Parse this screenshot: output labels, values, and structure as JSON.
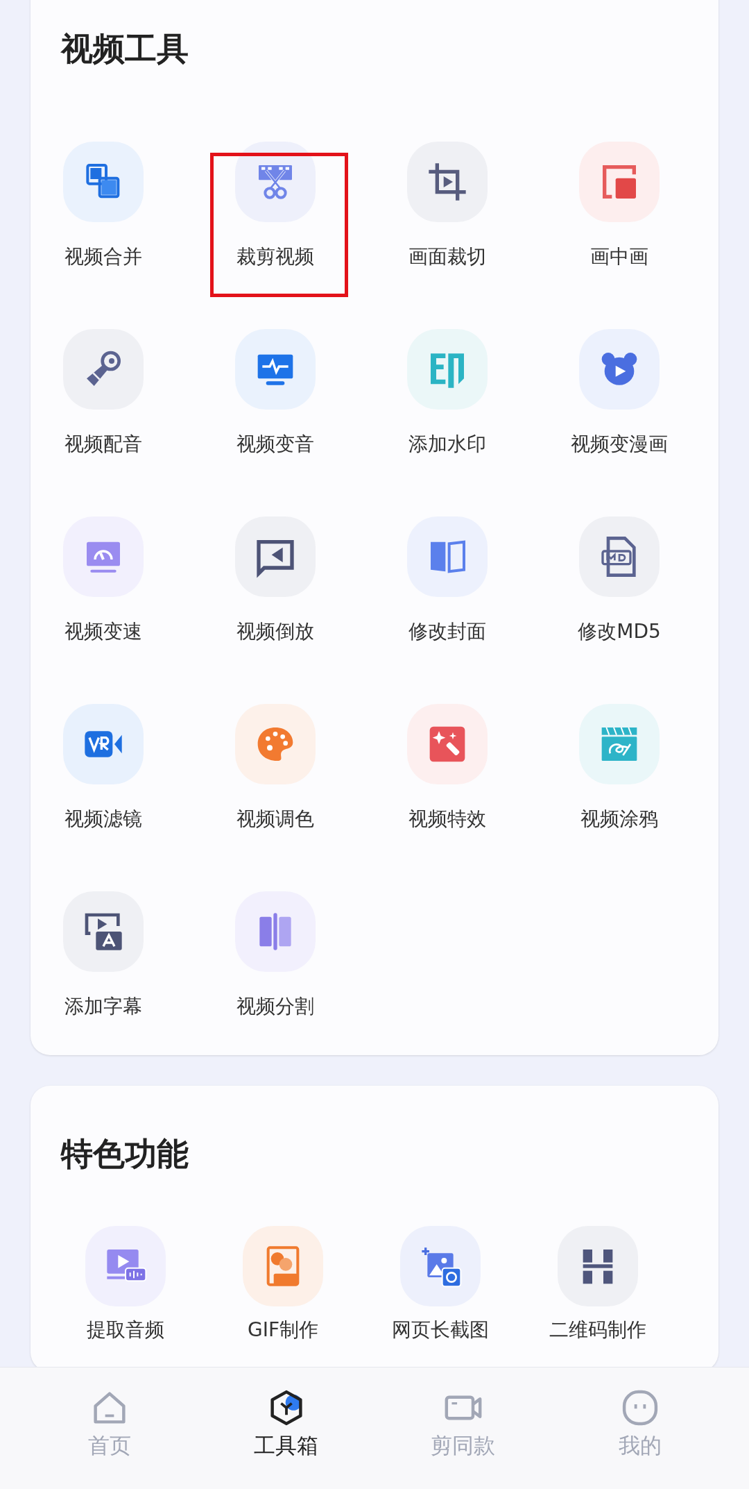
{
  "sections": [
    {
      "title": "视频工具",
      "items": [
        {
          "label": "视频合并",
          "highlighted": false
        },
        {
          "label": "裁剪视频",
          "highlighted": true
        },
        {
          "label": "画面裁切",
          "highlighted": false
        },
        {
          "label": "画中画",
          "highlighted": false
        },
        {
          "label": "视频配音",
          "highlighted": false
        },
        {
          "label": "视频变音",
          "highlighted": false
        },
        {
          "label": "添加水印",
          "highlighted": false
        },
        {
          "label": "视频变漫画",
          "highlighted": false
        },
        {
          "label": "视频变速",
          "highlighted": false
        },
        {
          "label": "视频倒放",
          "highlighted": false
        },
        {
          "label": "修改封面",
          "highlighted": false
        },
        {
          "label": "修改MD5",
          "highlighted": false
        },
        {
          "label": "视频滤镜",
          "highlighted": false
        },
        {
          "label": "视频调色",
          "highlighted": false
        },
        {
          "label": "视频特效",
          "highlighted": false
        },
        {
          "label": "视频涂鸦",
          "highlighted": false
        },
        {
          "label": "添加字幕",
          "highlighted": false
        },
        {
          "label": "视频分割",
          "highlighted": false
        }
      ]
    },
    {
      "title": "特色功能",
      "items": [
        {
          "label": "提取音频",
          "highlighted": false
        },
        {
          "label": "GIF制作",
          "highlighted": false
        },
        {
          "label": "网页长截图",
          "highlighted": false
        },
        {
          "label": "二维码制作",
          "highlighted": false
        }
      ]
    }
  ],
  "tabs": [
    {
      "label": "首页",
      "selected": false
    },
    {
      "label": "工具箱",
      "selected": true
    },
    {
      "label": "剪同款",
      "selected": false
    },
    {
      "label": "我的",
      "selected": false
    }
  ]
}
